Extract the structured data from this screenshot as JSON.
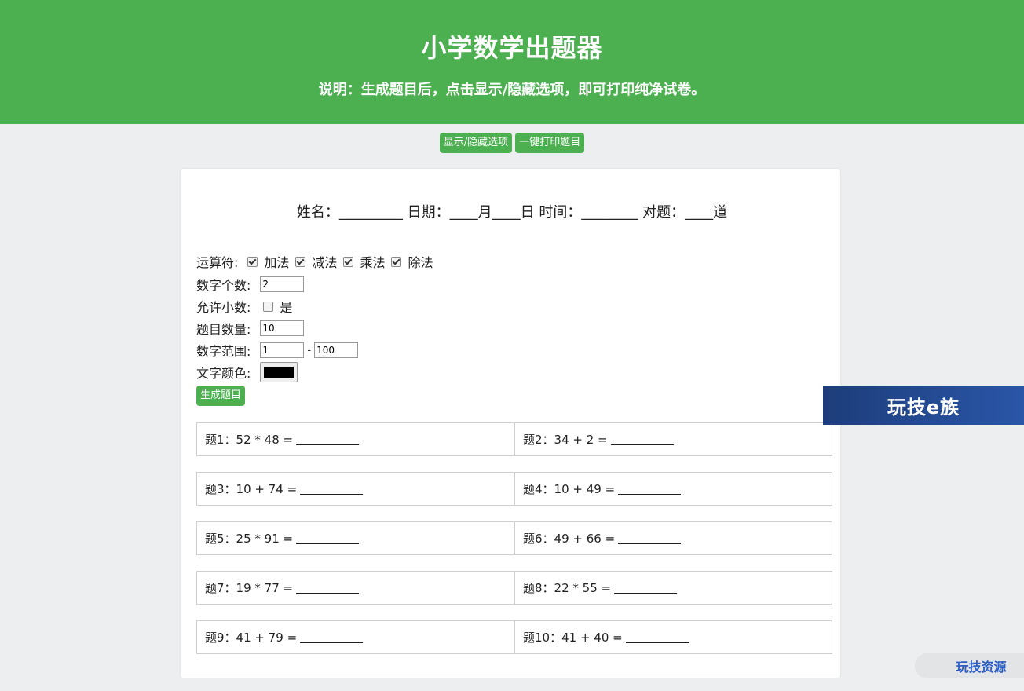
{
  "header": {
    "title": "小学数学出题器",
    "subtitle": "说明：生成题目后，点击显示/隐藏选项，即可打印纯净试卷。"
  },
  "toolbar": {
    "toggle_label": "显示/隐藏选项",
    "print_label": "一键打印题目"
  },
  "info_line": "姓名：_________ 日期：____月____日 时间：________ 对题：____道",
  "options": {
    "operators_label": "运算符:",
    "operators": [
      {
        "label": "加法",
        "checked": true
      },
      {
        "label": "减法",
        "checked": true
      },
      {
        "label": "乘法",
        "checked": true
      },
      {
        "label": "除法",
        "checked": true
      }
    ],
    "num_count_label": "数字个数:",
    "num_count_value": "2",
    "decimal_label": "允许小数:",
    "decimal_option": "是",
    "decimal_checked": false,
    "question_count_label": "题目数量:",
    "question_count_value": "10",
    "range_label": "数字范围:",
    "range_min": "1",
    "range_sep": "-",
    "range_max": "100",
    "color_label": "文字颜色:",
    "color_value": "#000000",
    "generate_label": "生成题目"
  },
  "questions": [
    {
      "label": "题1：",
      "expr": "52 * 48 ="
    },
    {
      "label": "题2：",
      "expr": "34 + 2 ="
    },
    {
      "label": "题3：",
      "expr": "10 + 74 ="
    },
    {
      "label": "题4：",
      "expr": "10 + 49 ="
    },
    {
      "label": "题5：",
      "expr": "25 * 91 ="
    },
    {
      "label": "题6：",
      "expr": "49 + 66 ="
    },
    {
      "label": "题7：",
      "expr": "19 * 77 ="
    },
    {
      "label": "题8：",
      "expr": "22 * 55 ="
    },
    {
      "label": "题9：",
      "expr": "41 + 79 ="
    },
    {
      "label": "题10：",
      "expr": "41 + 40 ="
    }
  ],
  "watermarks": {
    "banner_text": "玩技e族",
    "corner_text": "玩技资源"
  },
  "colors": {
    "accent": "#4caf50",
    "background": "#eceeef"
  }
}
